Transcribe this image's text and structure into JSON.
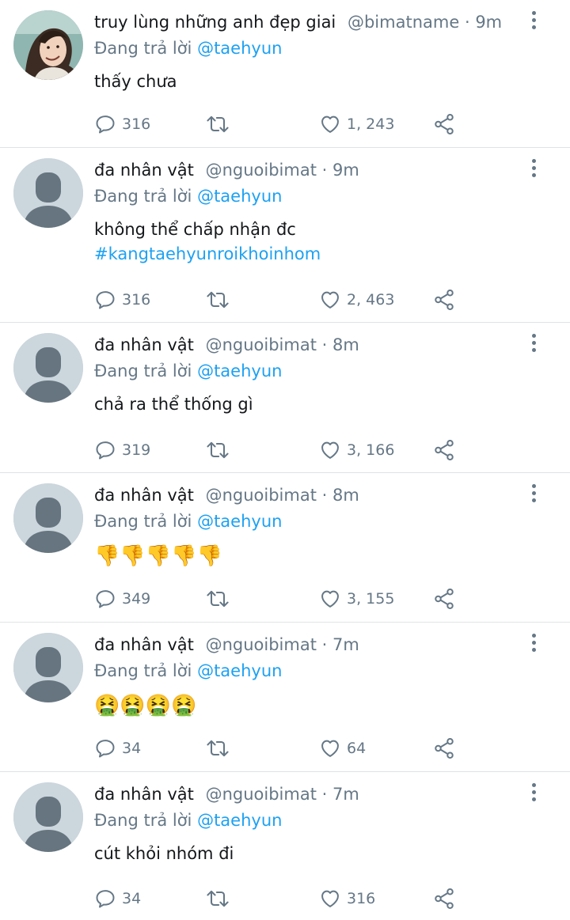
{
  "tweets": [
    {
      "avatar": "profile-photo",
      "name": "truy lùng những anh đẹp giai",
      "handle": "@bimatname",
      "separator": "·",
      "time": "9m",
      "reply_prefix": "Đang trả lời",
      "reply_to": "@taehyun",
      "text": "thấy chưa",
      "hashtag": "",
      "replies": "316",
      "likes": "1, 243"
    },
    {
      "avatar": "default",
      "name": "đa nhân vật",
      "handle": "@nguoibimat",
      "separator": "·",
      "time": "9m",
      "reply_prefix": "Đang trả lời",
      "reply_to": "@taehyun",
      "text": "không thể chấp nhận đc",
      "hashtag": "#kangtaehyunroikhoinhom",
      "replies": "316",
      "likes": "2, 463"
    },
    {
      "avatar": "default",
      "name": "đa nhân vật",
      "handle": "@nguoibimat",
      "separator": "·",
      "time": "8m",
      "reply_prefix": "Đang trả lời",
      "reply_to": "@taehyun",
      "text": "chả ra thể thống gì",
      "hashtag": "",
      "replies": "319",
      "likes": "3, 166"
    },
    {
      "avatar": "default",
      "name": "đa nhân vật",
      "handle": "@nguoibimat",
      "separator": "·",
      "time": "8m",
      "reply_prefix": "Đang trả lời",
      "reply_to": "@taehyun",
      "text": "👎👎👎👎👎",
      "hashtag": "",
      "replies": "349",
      "likes": "3, 155"
    },
    {
      "avatar": "default",
      "name": "đa nhân vật",
      "handle": "@nguoibimat",
      "separator": "·",
      "time": "7m",
      "reply_prefix": "Đang trả lời",
      "reply_to": "@taehyun",
      "text": "🤮🤮🤮🤮",
      "hashtag": "",
      "replies": "34",
      "likes": "64"
    },
    {
      "avatar": "default",
      "name": "đa nhân vật",
      "handle": "@nguoibimat",
      "separator": "·",
      "time": "7m",
      "reply_prefix": "Đang trả lời",
      "reply_to": "@taehyun",
      "text": "cút khỏi nhóm đi",
      "hashtag": "",
      "replies": "34",
      "likes": "316"
    }
  ],
  "icons": {
    "reply": "reply-icon",
    "retweet": "retweet-icon",
    "like": "heart-icon",
    "share": "share-icon",
    "more": "more-icon"
  },
  "colors": {
    "mention": "#1da1f2",
    "muted": "#657786",
    "divider": "#dfe3e7",
    "default_avatar_bg": "#ccd6dd",
    "default_avatar_fg": "#66757f"
  }
}
